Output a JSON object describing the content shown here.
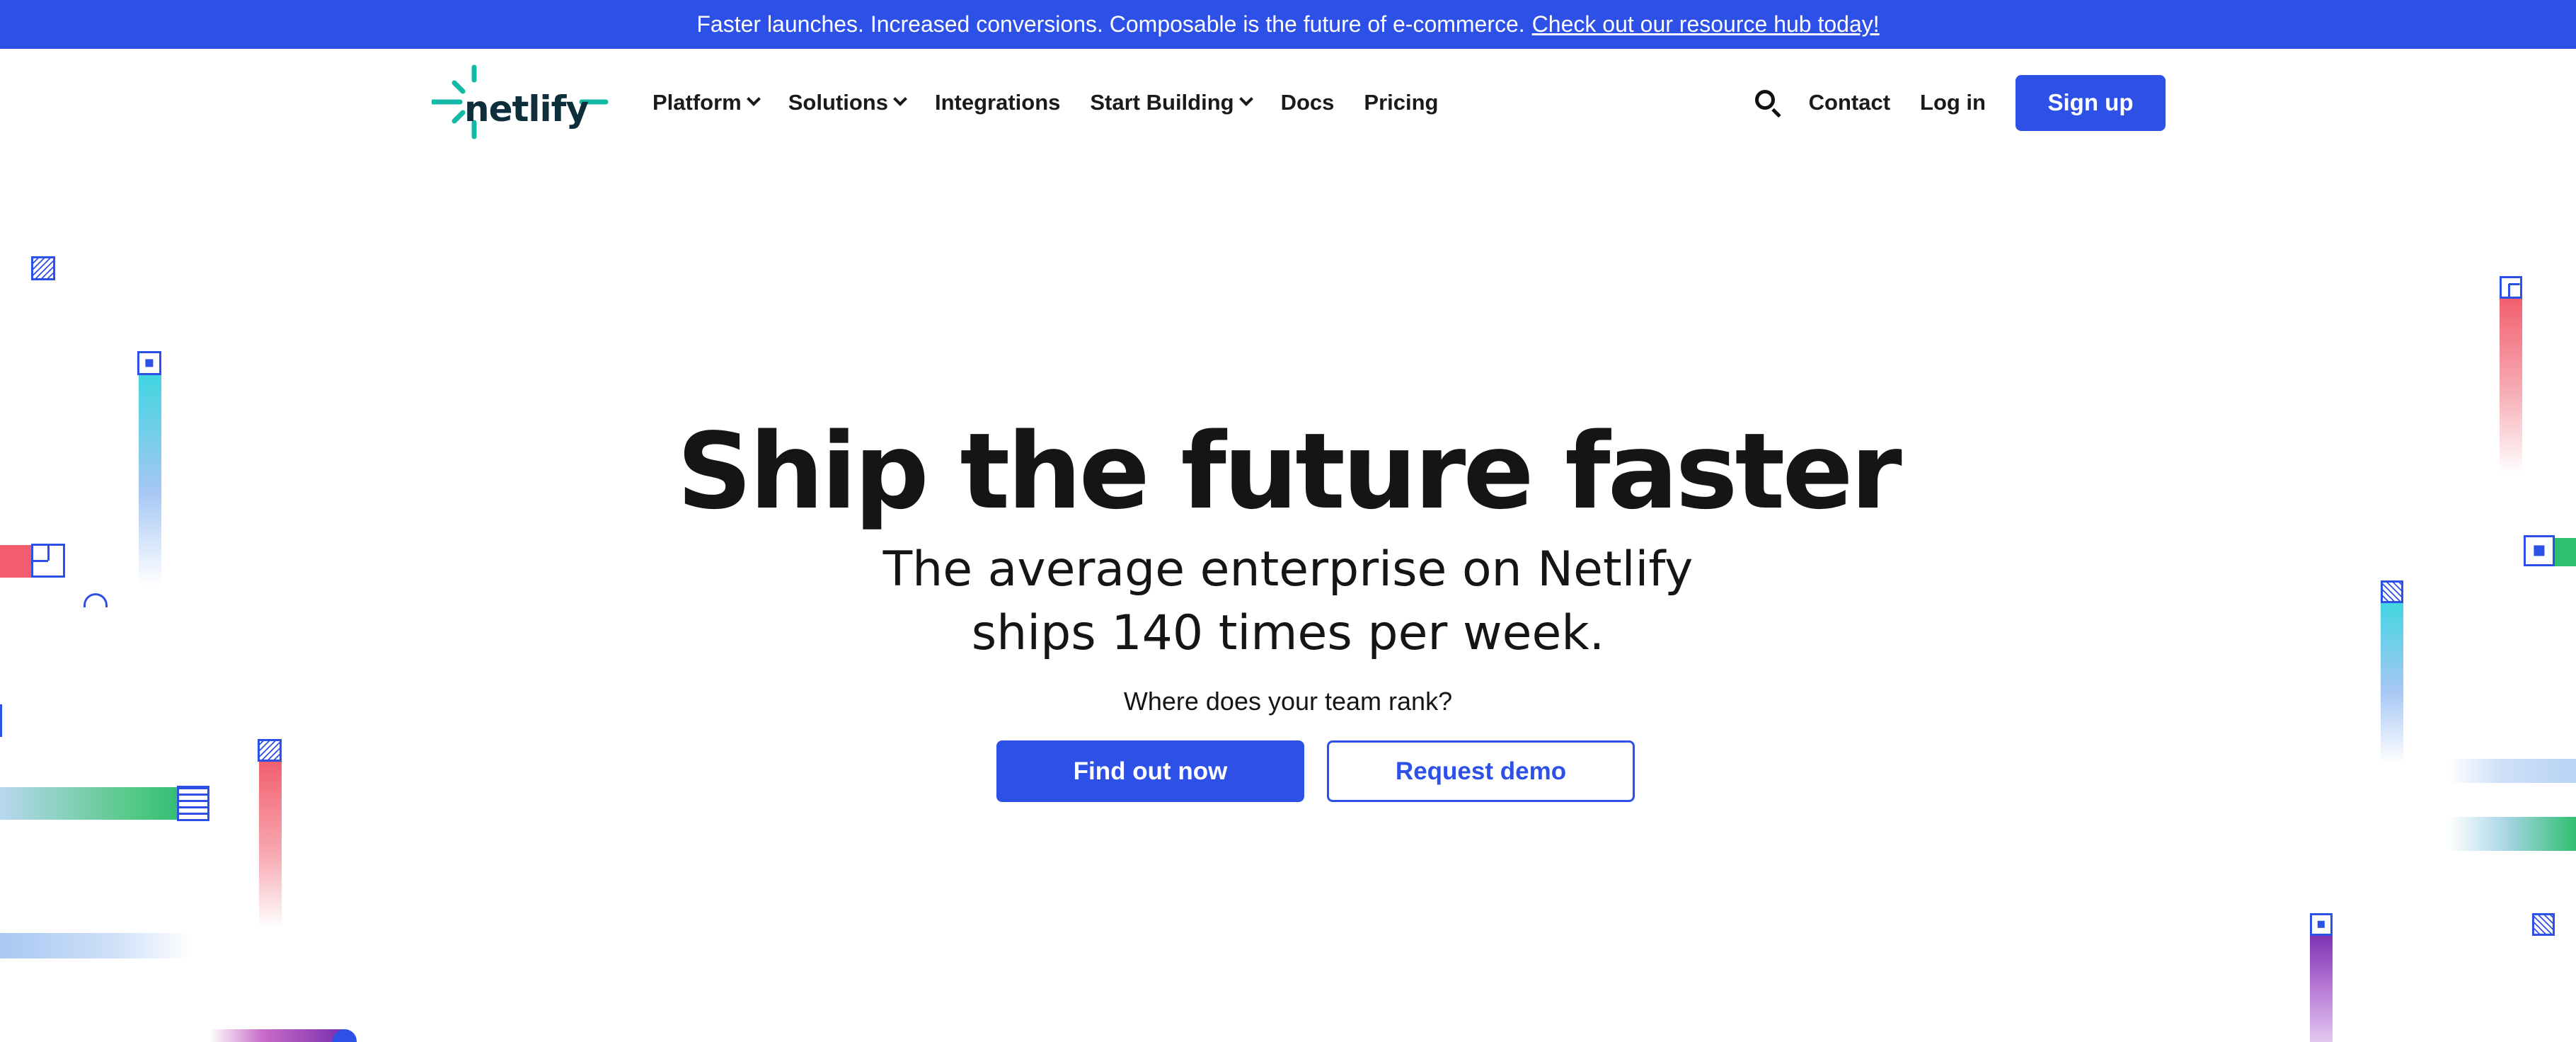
{
  "banner": {
    "text": "Faster launches. Increased conversions. Composable is the future of e-commerce.",
    "link": "Check out our resource hub today!"
  },
  "header": {
    "logo_text": "netlify",
    "nav": [
      {
        "label": "Platform",
        "dropdown": true
      },
      {
        "label": "Solutions",
        "dropdown": true
      },
      {
        "label": "Integrations",
        "dropdown": false
      },
      {
        "label": "Start Building",
        "dropdown": true
      },
      {
        "label": "Docs",
        "dropdown": false
      },
      {
        "label": "Pricing",
        "dropdown": false
      }
    ],
    "contact_label": "Contact",
    "login_label": "Log in",
    "signup_label": "Sign up"
  },
  "hero": {
    "title": "Ship the future faster",
    "subtitle_line1": "The average enterprise on Netlify",
    "subtitle_line2": "ships 140 times per week.",
    "question": "Where does your team rank?",
    "primary_cta": "Find out now",
    "secondary_cta": "Request demo"
  },
  "colors": {
    "brand_blue": "#2d50e6",
    "logo_teal": "#14b8a6",
    "logo_text": "#0d2e3a"
  },
  "icons": [
    "netlify-logo-icon",
    "chevron-down-icon",
    "search-icon"
  ]
}
